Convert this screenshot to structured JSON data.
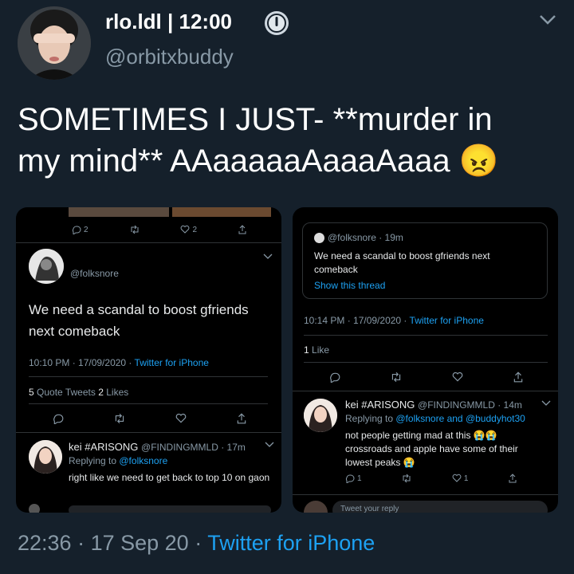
{
  "tweet": {
    "display_name": "rlo.ldl | 12:00",
    "handle": "@orbitxbuddy",
    "text_line1": "SOMETIMES I JUST- **murder in",
    "text_line2": "my mind** AAaaaaaAaaaAaaa",
    "emoji": "😠",
    "time": "22:36",
    "date": "17 Sep 20",
    "source": "Twitter for iPhone"
  },
  "left_shot": {
    "top_reply_count": "2",
    "top_like_count": "2",
    "author": "@folksnore",
    "text": "We need a scandal to boost gfriends next comeback",
    "timestamp": "10:10 PM · 17/09/2020 · ",
    "source": "Twitter for iPhone",
    "quote_count": "5",
    "quote_label": "Quote Tweets",
    "like_count": "2",
    "like_label": "Likes",
    "reply": {
      "name": "kei #ARISONG",
      "handle_time": "@FINDINGMMLD · 17m",
      "replying_prefix": "Replying to ",
      "replying_to": "@folksnore",
      "text": "right like we need to get back to top 10 on gaon"
    }
  },
  "right_shot": {
    "quoted_author": "@folksnore · 19m",
    "quoted_text": "We need a scandal to boost gfriends next comeback",
    "show_thread": "Show this thread",
    "timestamp": "10:14 PM · 17/09/2020 · ",
    "source": "Twitter for iPhone",
    "like_count": "1",
    "like_label": "Like",
    "reply": {
      "name": "kei #ARISONG",
      "handle_time": "@FINDINGMMLD · 14m",
      "replying_prefix": "Replying to ",
      "replying_to": "@folksnore and @buddyhot30",
      "text": "not people getting mad at this 😭😭 crossroads and apple have some of their lowest peaks 😭",
      "reply_count": "1",
      "like_count": "1"
    },
    "compose_placeholder": "Tweet your reply"
  },
  "colors": {
    "background": "#15202b",
    "link": "#1da1f2",
    "secondary_text": "#8899a6"
  }
}
